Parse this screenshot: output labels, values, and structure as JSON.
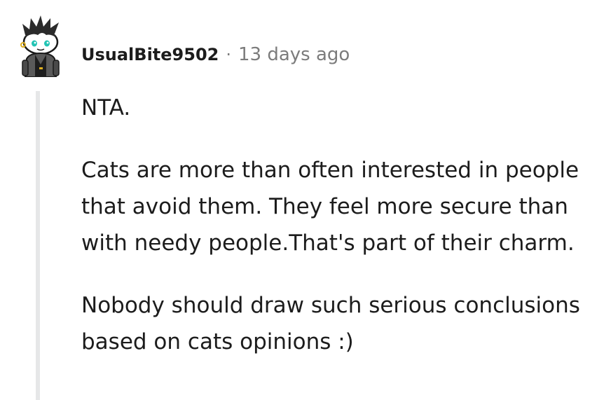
{
  "comment": {
    "author": "UsualBite9502",
    "separator": "·",
    "timestamp": "13 days ago",
    "avatar_icon": "snoo-avatar-icon",
    "paragraphs": [
      "NTA.",
      "Cats are more than often interested in people that avoid them. They feel more secure than with needy people.That's part of their charm.",
      "Nobody should draw such serious conclusions based on cats opinions :)"
    ]
  }
}
